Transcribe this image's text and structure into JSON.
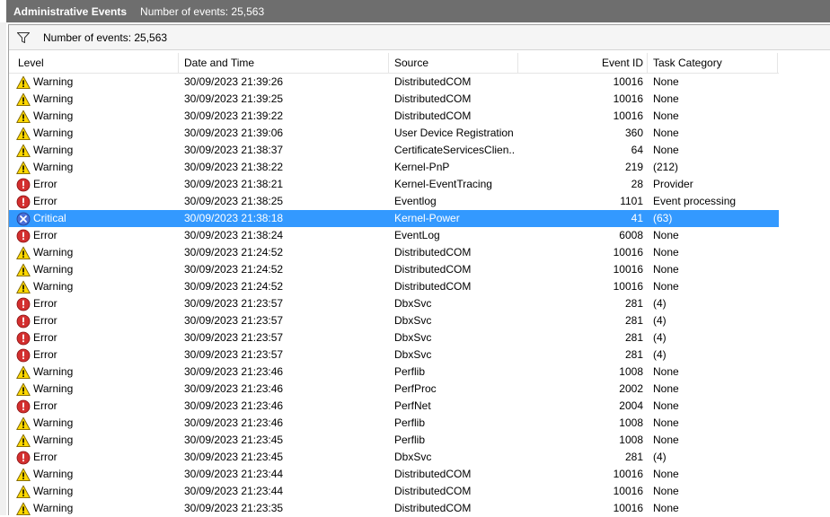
{
  "header": {
    "title": "Administrative Events",
    "count_label": "Number of events: 25,563"
  },
  "filter_bar": {
    "icon": "filter-icon",
    "text": "Number of events: 25,563"
  },
  "columns": [
    "Level",
    "Date and Time",
    "Source",
    "Event ID",
    "Task Category"
  ],
  "level_icons": {
    "Warning": "warning-icon",
    "Error": "error-icon",
    "Critical": "critical-icon"
  },
  "colors": {
    "title_bar": "#6e6e6e",
    "selection": "#3399ff",
    "warning": "#ffd800",
    "error": "#d32f2f",
    "critical": "#4a6fd8"
  },
  "selected_row": 8,
  "rows": [
    {
      "level": "Warning",
      "date": "30/09/2023 21:39:26",
      "source": "DistributedCOM",
      "id": "10016",
      "task": "None"
    },
    {
      "level": "Warning",
      "date": "30/09/2023 21:39:25",
      "source": "DistributedCOM",
      "id": "10016",
      "task": "None"
    },
    {
      "level": "Warning",
      "date": "30/09/2023 21:39:22",
      "source": "DistributedCOM",
      "id": "10016",
      "task": "None"
    },
    {
      "level": "Warning",
      "date": "30/09/2023 21:39:06",
      "source": "User Device Registration",
      "id": "360",
      "task": "None"
    },
    {
      "level": "Warning",
      "date": "30/09/2023 21:38:37",
      "source": "CertificateServicesClien...",
      "id": "64",
      "task": "None"
    },
    {
      "level": "Warning",
      "date": "30/09/2023 21:38:22",
      "source": "Kernel-PnP",
      "id": "219",
      "task": "(212)"
    },
    {
      "level": "Error",
      "date": "30/09/2023 21:38:21",
      "source": "Kernel-EventTracing",
      "id": "28",
      "task": "Provider"
    },
    {
      "level": "Error",
      "date": "30/09/2023 21:38:25",
      "source": "Eventlog",
      "id": "1101",
      "task": "Event processing"
    },
    {
      "level": "Critical",
      "date": "30/09/2023 21:38:18",
      "source": "Kernel-Power",
      "id": "41",
      "task": "(63)"
    },
    {
      "level": "Error",
      "date": "30/09/2023 21:38:24",
      "source": "EventLog",
      "id": "6008",
      "task": "None"
    },
    {
      "level": "Warning",
      "date": "30/09/2023 21:24:52",
      "source": "DistributedCOM",
      "id": "10016",
      "task": "None"
    },
    {
      "level": "Warning",
      "date": "30/09/2023 21:24:52",
      "source": "DistributedCOM",
      "id": "10016",
      "task": "None"
    },
    {
      "level": "Warning",
      "date": "30/09/2023 21:24:52",
      "source": "DistributedCOM",
      "id": "10016",
      "task": "None"
    },
    {
      "level": "Error",
      "date": "30/09/2023 21:23:57",
      "source": "DbxSvc",
      "id": "281",
      "task": "(4)"
    },
    {
      "level": "Error",
      "date": "30/09/2023 21:23:57",
      "source": "DbxSvc",
      "id": "281",
      "task": "(4)"
    },
    {
      "level": "Error",
      "date": "30/09/2023 21:23:57",
      "source": "DbxSvc",
      "id": "281",
      "task": "(4)"
    },
    {
      "level": "Error",
      "date": "30/09/2023 21:23:57",
      "source": "DbxSvc",
      "id": "281",
      "task": "(4)"
    },
    {
      "level": "Warning",
      "date": "30/09/2023 21:23:46",
      "source": "Perflib",
      "id": "1008",
      "task": "None"
    },
    {
      "level": "Warning",
      "date": "30/09/2023 21:23:46",
      "source": "PerfProc",
      "id": "2002",
      "task": "None"
    },
    {
      "level": "Error",
      "date": "30/09/2023 21:23:46",
      "source": "PerfNet",
      "id": "2004",
      "task": "None"
    },
    {
      "level": "Warning",
      "date": "30/09/2023 21:23:46",
      "source": "Perflib",
      "id": "1008",
      "task": "None"
    },
    {
      "level": "Warning",
      "date": "30/09/2023 21:23:45",
      "source": "Perflib",
      "id": "1008",
      "task": "None"
    },
    {
      "level": "Error",
      "date": "30/09/2023 21:23:45",
      "source": "DbxSvc",
      "id": "281",
      "task": "(4)"
    },
    {
      "level": "Warning",
      "date": "30/09/2023 21:23:44",
      "source": "DistributedCOM",
      "id": "10016",
      "task": "None"
    },
    {
      "level": "Warning",
      "date": "30/09/2023 21:23:44",
      "source": "DistributedCOM",
      "id": "10016",
      "task": "None"
    },
    {
      "level": "Warning",
      "date": "30/09/2023 21:23:35",
      "source": "DistributedCOM",
      "id": "10016",
      "task": "None"
    }
  ]
}
